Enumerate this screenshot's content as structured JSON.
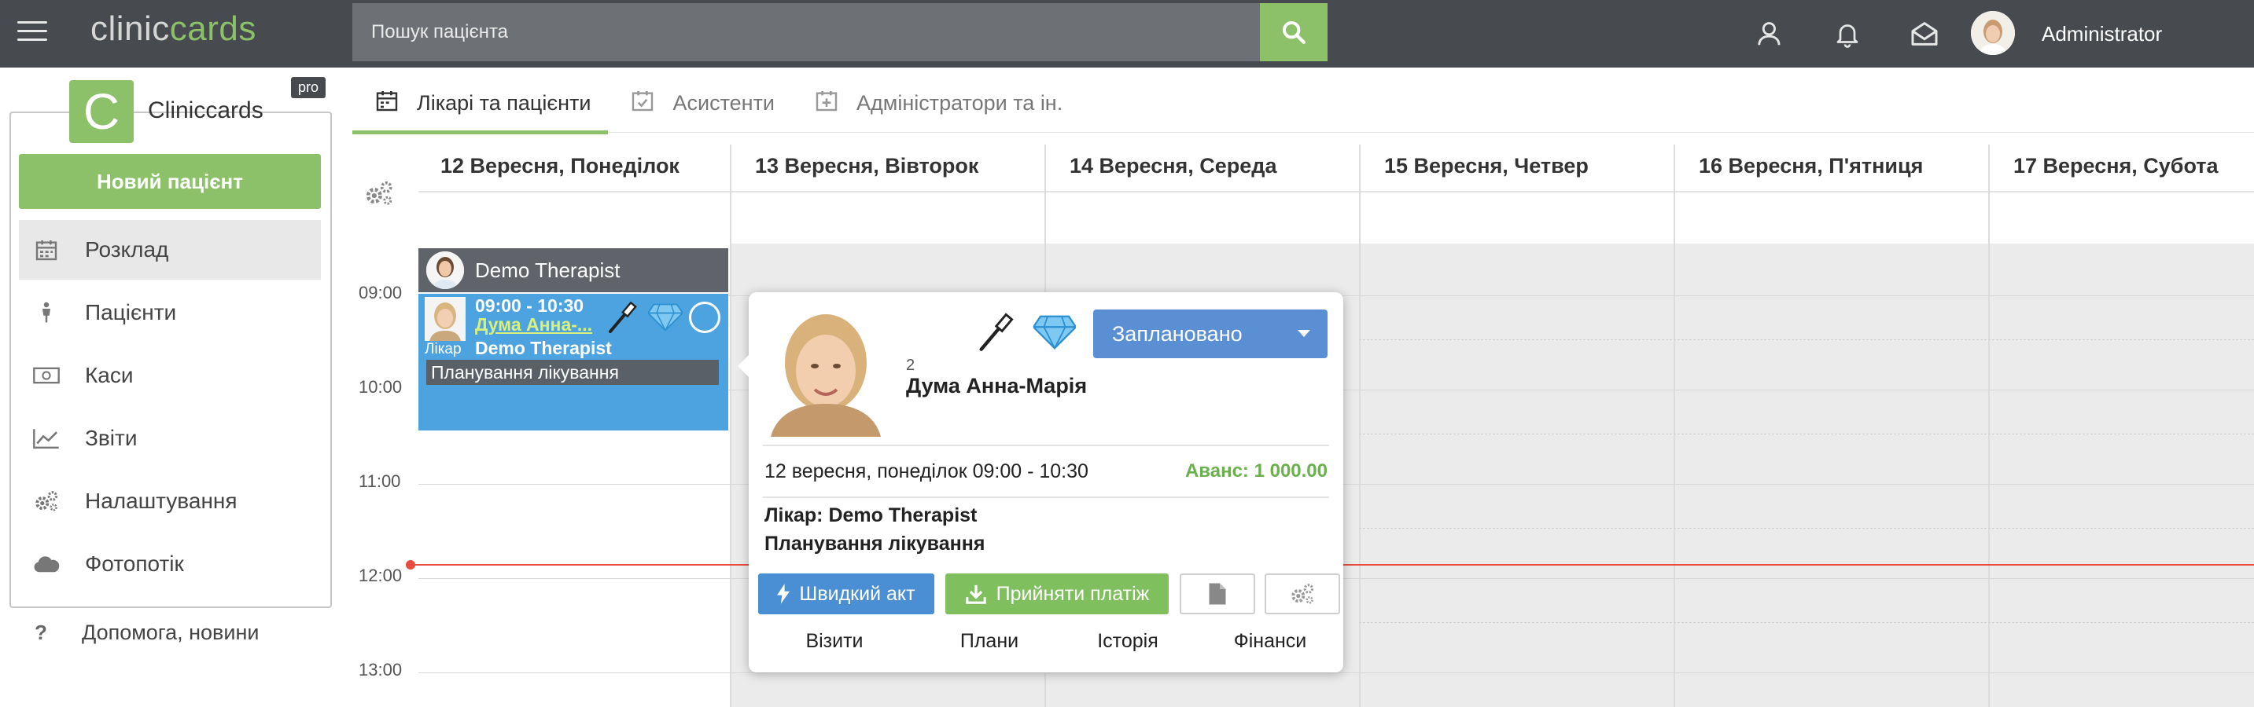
{
  "topbar": {
    "logo_part1": "clinic",
    "logo_part2": "cards",
    "search_placeholder": "Пошук пацієнта",
    "user_name": "Administrator"
  },
  "sidebar": {
    "brand_letter": "C",
    "brand_name": "Cliniccards",
    "pro_badge": "pro",
    "new_patient_label": "Новий пацієнт",
    "items": [
      {
        "label": "Розклад",
        "icon": "calendar-icon",
        "active": true
      },
      {
        "label": "Пацієнти",
        "icon": "person-icon",
        "active": false
      },
      {
        "label": "Каси",
        "icon": "cash-icon",
        "active": false
      },
      {
        "label": "Звіти",
        "icon": "chart-icon",
        "active": false
      },
      {
        "label": "Налаштування",
        "icon": "gears-icon",
        "active": false
      },
      {
        "label": "Фотопотік",
        "icon": "cloud-icon",
        "active": false
      }
    ],
    "help_label": "Допомога, новини"
  },
  "tabs": [
    {
      "label": "Лікарі та пацієнти",
      "active": true
    },
    {
      "label": "Асистенти",
      "active": false
    },
    {
      "label": "Адміністратори та ін.",
      "active": false
    }
  ],
  "calendar": {
    "days": [
      "12 Вересня, Понеділок",
      "13 Вересня, Вівторок",
      "14 Вересня, Середа",
      "15 Вересня, Четвер",
      "16 Вересня, П'ятниця",
      "17 Вересня, Субота"
    ],
    "times": [
      "09:00",
      "10:00",
      "11:00",
      "12:00",
      "13:00"
    ],
    "doctor_name": "Demo Therapist",
    "appointment": {
      "time": "09:00 - 10:30",
      "patient_short": "Дума Анна-...",
      "doctor_label": "Лікар",
      "doctor_name": "Demo Therapist",
      "plan": "Планування лікування"
    }
  },
  "popup": {
    "patient_number": "2",
    "patient_name": "Дума Анна-Марія",
    "status": "Заплановано",
    "date_time": "12 вересня, понеділок 09:00 - 10:30",
    "advance": "Аванс: 1 000.00",
    "doctor": "Лікар: Demo Therapist",
    "plan": "Планування лікування",
    "quick_act": "Швидкий акт",
    "accept_payment": "Прийняти платіж",
    "links": [
      "Візити",
      "Плани",
      "Історія",
      "Фінанси"
    ]
  },
  "colors": {
    "topbar": "#474a4f",
    "accent_green": "#8cc16a",
    "appointment_blue": "#4da3e0",
    "status_blue": "#5b8fd4",
    "now_line": "#e74c3c"
  }
}
